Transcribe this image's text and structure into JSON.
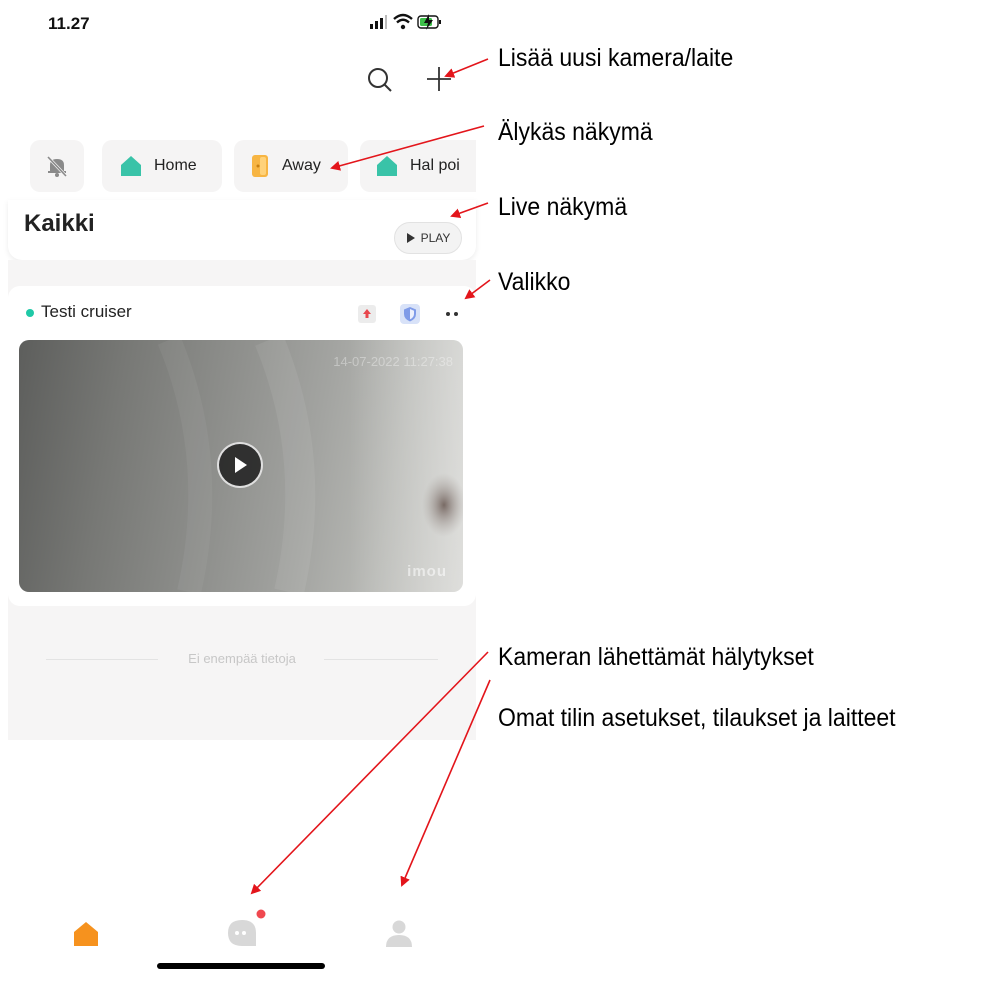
{
  "status_bar": {
    "time": "11.27"
  },
  "modes": [
    {
      "label": ""
    },
    {
      "label": "Home"
    },
    {
      "label": "Away"
    },
    {
      "label": "Hal poi"
    }
  ],
  "section": {
    "title": "Kaikki",
    "play_label": "PLAY"
  },
  "device": {
    "name": "Testi cruiser",
    "timestamp": "14-07-2022 11:27:38",
    "brand": "imou",
    "status_color": "#1fc9a7"
  },
  "list_footer": "Ei enempää tietoja",
  "nav": {
    "active_color": "#f6921e",
    "badge_color": "#f0484f"
  },
  "annotations": {
    "add_device": "Lisää uusi kamera/laite",
    "smart_view": "Älykäs näkymä",
    "live_view": "Live näkymä",
    "menu": "Valikko",
    "alarms": "Kameran lähettämät hälytykset",
    "account": "Omat tilin asetukset, tilaukset ja laitteet"
  }
}
